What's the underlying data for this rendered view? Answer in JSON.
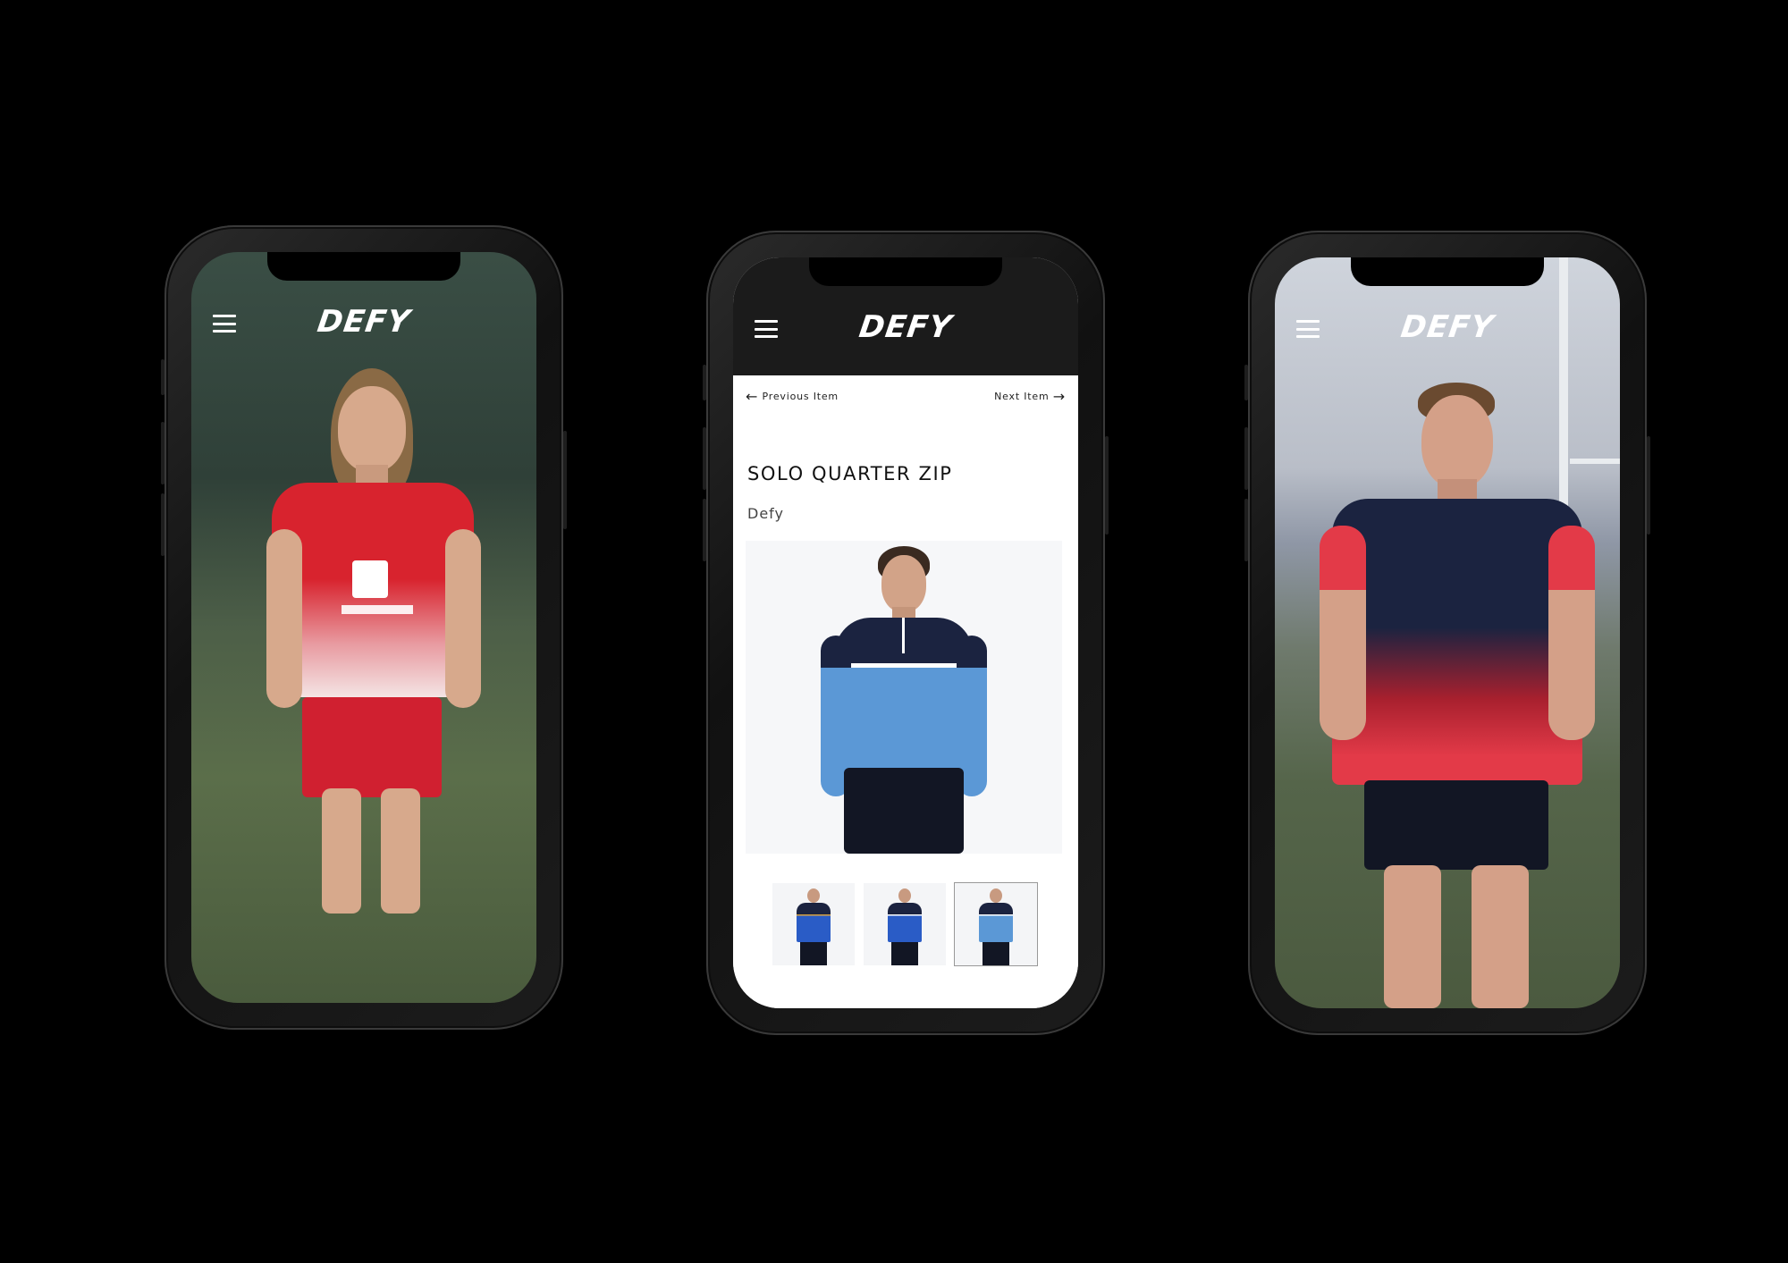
{
  "phones": [
    {
      "logo": "DEFY",
      "menu_icon": "hamburger-icon",
      "hero": "woman-red-jersey"
    },
    {
      "logo": "DEFY",
      "menu_icon": "hamburger-icon",
      "nav": {
        "previous_label": "Previous Item",
        "next_label": "Next Item",
        "previous_icon": "arrow-left-icon",
        "next_icon": "arrow-right-icon"
      },
      "product": {
        "title": "SOLO QUARTER ZIP",
        "brand": "Defy",
        "thumbnails": [
          "navy-royal",
          "navy-royal-alt",
          "navy-sky"
        ],
        "selected_thumbnail": 2
      }
    },
    {
      "logo": "DEFY",
      "menu_icon": "hamburger-icon",
      "hero": "man-black-red-jersey"
    }
  ],
  "colors": {
    "background": "#000000",
    "jersey_red": "#d8232e",
    "jersey_navy": "#1b2340",
    "zip_sky_blue": "#5b98d6"
  }
}
